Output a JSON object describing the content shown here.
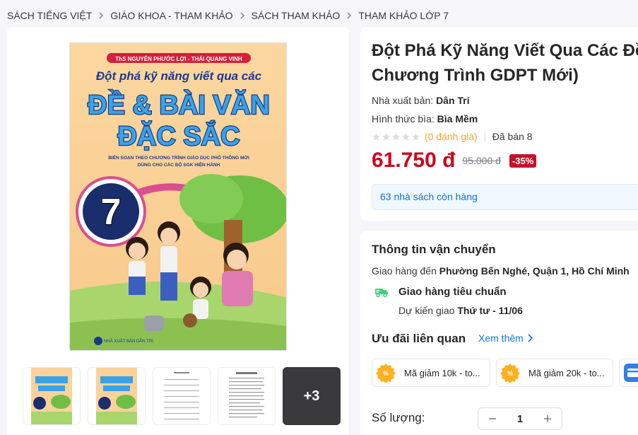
{
  "breadcrumb": {
    "items": [
      "Sách tiếng Việt",
      "Giáo Khoa - Tham Khảo",
      "Sách Tham Khảo",
      "Tham Khảo Lớp 7"
    ]
  },
  "gallery": {
    "cover": {
      "author_line": "ThS NGUYỄN PHƯỚC LỢI - THÁI QUANG VINH",
      "title_line1": "Đột phá kỹ năng viết qua các",
      "title_line2": "ĐỀ & BÀI VĂN",
      "title_line3": "ĐẶC SẮC",
      "sub_line1": "BIÊN SOẠN THEO CHƯƠNG TRÌNH GIÁO DỤC PHỔ THÔNG MỚI",
      "sub_line2": "DÙNG CHO CÁC BỘ SGK HIỆN HÀNH",
      "grade": "7",
      "publisher": "NHÀ XUẤT BẢN DÂN TRÍ"
    },
    "more_label": "+3"
  },
  "product": {
    "title_line1": "Đột Phá Kỹ Năng Viết Qua Các Đề V",
    "title_line2": "Chương Trình GDPT Mới)",
    "publisher_label": "Nhà xuất bản:",
    "publisher": "Dân Trí",
    "cover_label": "Hình thức bìa:",
    "cover_type": "Bìa Mềm",
    "reviews": "(0 đánh giá)",
    "sold_label": "Đã bán",
    "sold_count": "8",
    "price": "61.750 đ",
    "original_price": "95.000 đ",
    "discount": "-35%",
    "stock": "63 nhà sách còn hàng"
  },
  "shipping": {
    "title": "Thông tin vận chuyển",
    "deliver_to_label": "Giao hàng đến",
    "address": "Phường Bến Nghé, Quận 1, Hồ Chí Minh",
    "method": "Giao hàng tiêu chuẩn",
    "eta_label": "Dự kiến giao",
    "eta": "Thứ tư - 11/06",
    "offers_title": "Ưu đãi liên quan",
    "see_more": "Xem thêm",
    "coupons": [
      "Mã giảm 10k - to...",
      "Mã giảm 20k - to..."
    ],
    "quantity_label": "Số lượng:",
    "quantity": "1"
  },
  "colors": {
    "price": "#d0011b",
    "link": "#0b74e5",
    "rating": "#f5a623",
    "coupon": "#fdb022"
  }
}
